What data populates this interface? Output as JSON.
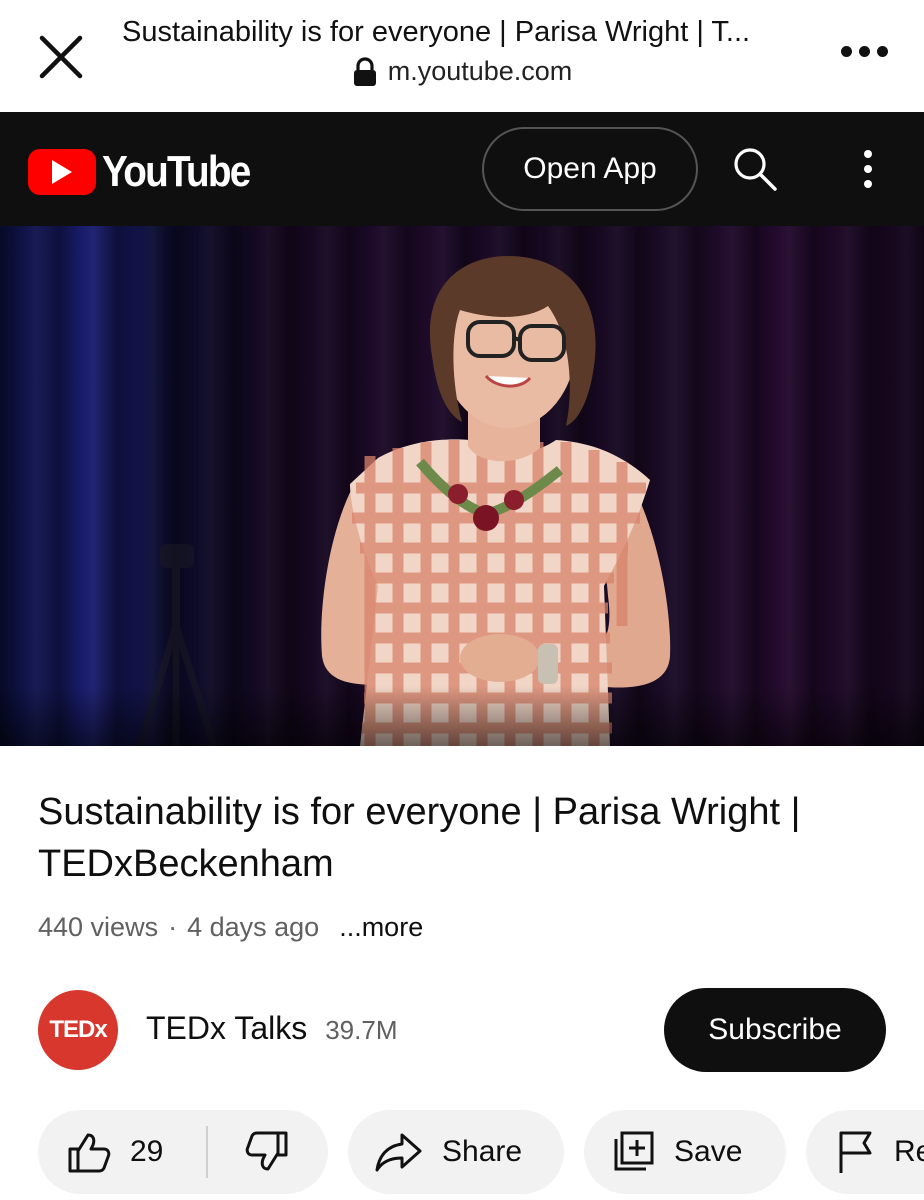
{
  "browser": {
    "page_title": "Sustainability is for everyone | Parisa Wright | T...",
    "url": "m.youtube.com"
  },
  "header": {
    "logo_text": "YouTube",
    "open_app_label": "Open App"
  },
  "video": {
    "title": "Sustainability is for everyone | Parisa Wright | TEDxBeckenham",
    "views": "440 views",
    "separator": "·",
    "posted": "4 days ago",
    "more_label": "...more"
  },
  "channel": {
    "avatar_text": "TEDx",
    "name": "TEDx Talks",
    "subscribers": "39.7M",
    "subscribe_label": "Subscribe"
  },
  "actions": {
    "like_count": "29",
    "share_label": "Share",
    "save_label": "Save",
    "report_label": "Re"
  },
  "colors": {
    "brand_red": "#ff0000",
    "header_bg": "#0f0f0f",
    "chip_bg": "#f2f2f2",
    "tedx_red": "#d7372c"
  },
  "icons": [
    "close-icon",
    "lock-icon",
    "more-horizontal-icon",
    "youtube-play-icon",
    "search-icon",
    "more-vertical-icon",
    "thumbs-up-icon",
    "thumbs-down-icon",
    "share-icon",
    "save-to-playlist-icon",
    "flag-icon"
  ]
}
